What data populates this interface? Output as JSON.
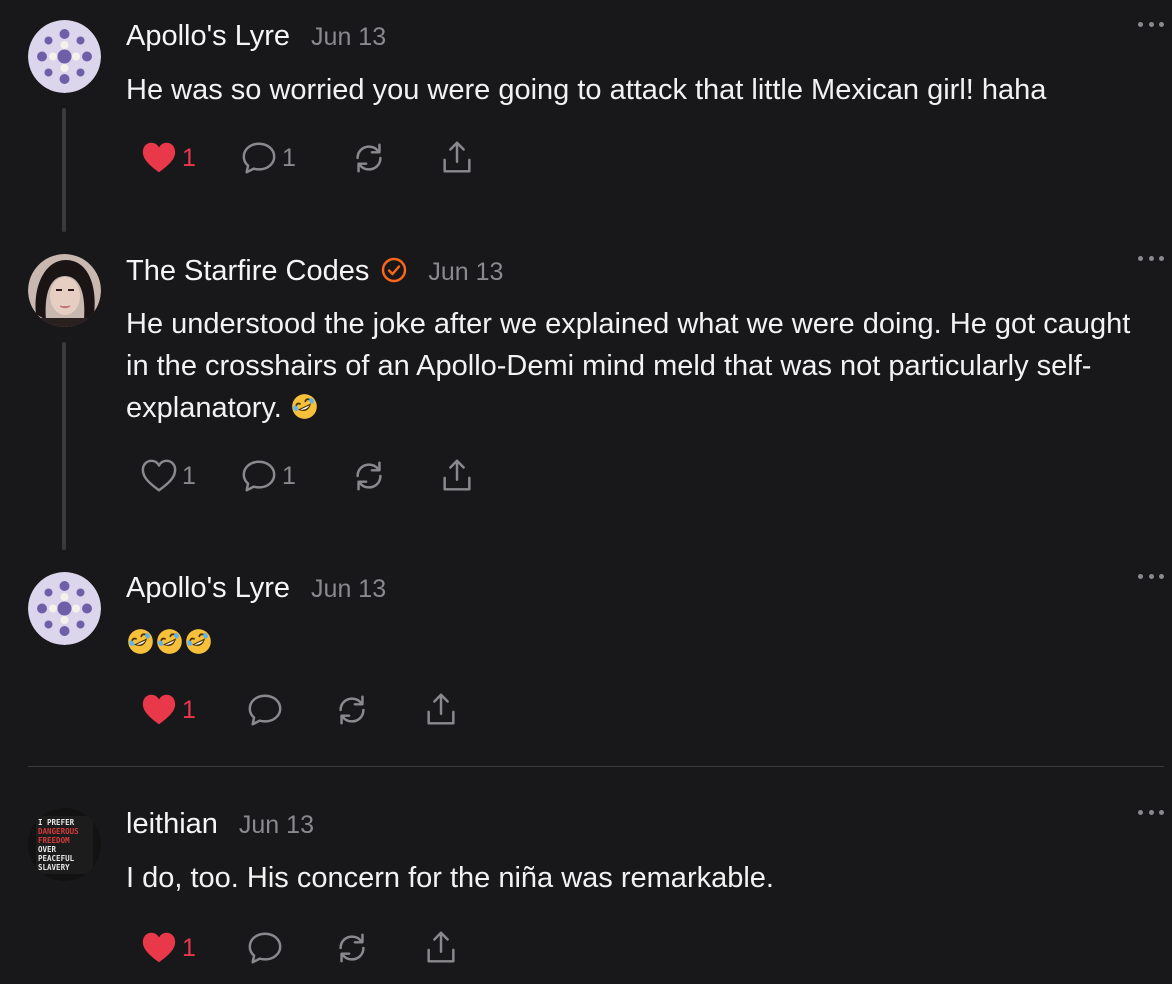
{
  "comments": [
    {
      "author": "Apollo's Lyre",
      "date": "Jun 13",
      "text": "He was so worried you were going to attack that little Mexican girl! haha",
      "likes": "1",
      "replies": "1",
      "liked": true
    },
    {
      "author": "The Starfire Codes",
      "verified": true,
      "date": "Jun 13",
      "text": "He understood the joke after we explained what we were doing. He got caught in the crosshairs of an Apollo-Demi mind meld that was not particularly self-explanatory.",
      "emoji": "rolling-on-floor-laughing",
      "likes": "1",
      "replies": "1",
      "liked": false
    },
    {
      "author": "Apollo's Lyre",
      "date": "Jun 13",
      "emoji_text": "🤣🤣🤣",
      "likes": "1",
      "replies": "",
      "liked": true
    },
    {
      "author": "leithian",
      "date": "Jun 13",
      "text": "I do, too. His concern for the niña was remarkable.",
      "likes": "1",
      "replies": "",
      "liked": true,
      "avatar_text": [
        "I PREFER",
        "DANGEROUS",
        "FREEDOM",
        "OVER",
        "PEACEFUL",
        "SLAVERY"
      ]
    }
  ],
  "colors": {
    "background": "#18181a",
    "like_red": "#e8384a",
    "muted": "#8a8a8e",
    "verified_orange": "#ff6719"
  },
  "icons": [
    "heart-icon",
    "comment-icon",
    "restack-icon",
    "share-icon",
    "more-icon",
    "verified-icon"
  ]
}
